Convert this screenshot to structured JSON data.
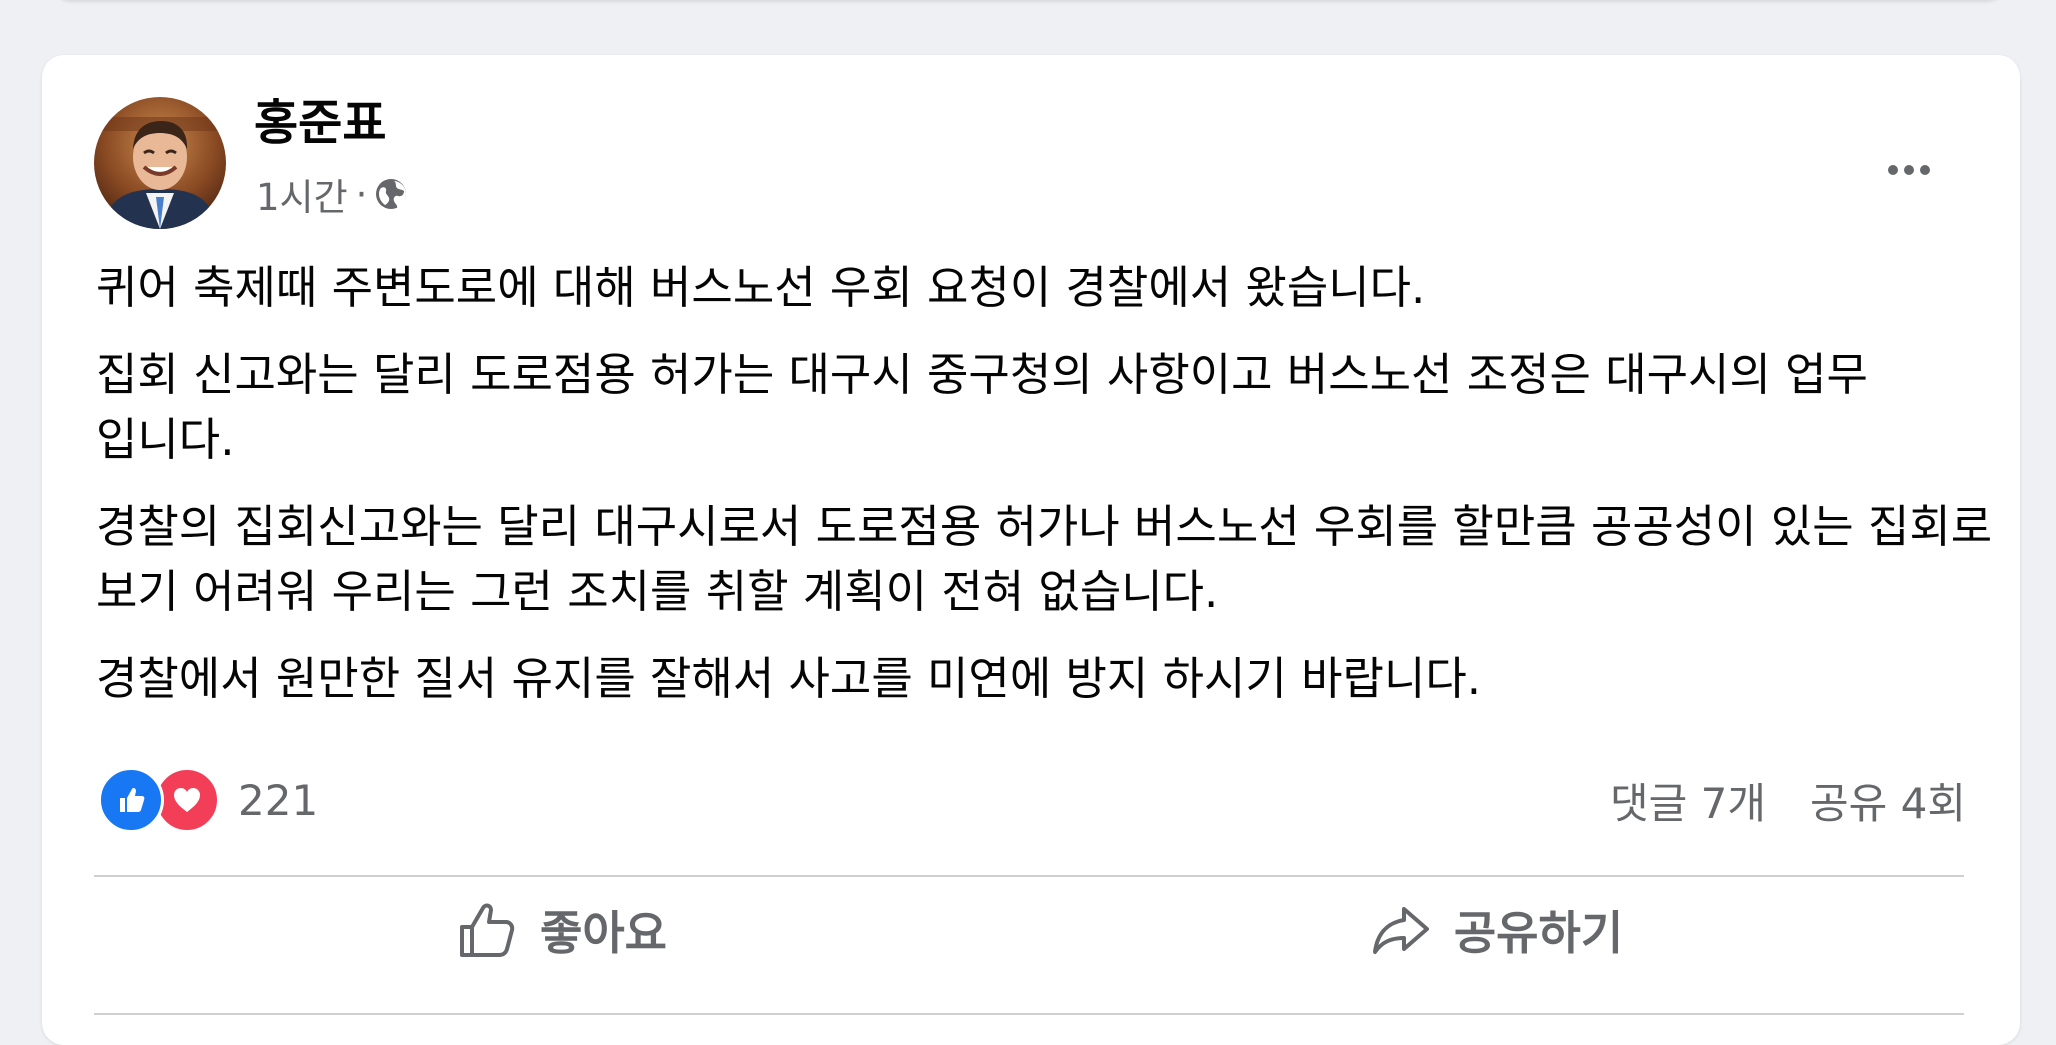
{
  "post": {
    "author": "홍준표",
    "time": "1시간",
    "separator": "·",
    "privacy_icon": "globe-icon",
    "more_icon": "more-options-icon",
    "paragraphs": [
      "퀴어 축제때 주변도로에 대해 버스노선 우회 요청이 경찰에서 왔습니다.",
      "집회 신고와는 달리 도로점용 허가는 대구시 중구청의 사항이고 버스노선 조정은 대구시의 업무 입니다.",
      "경찰의 집회신고와는 달리 대구시로서 도로점용 허가나 버스노선 우회를 할만큼 공공성이 있는 집회로 보기 어려워 우리는 그런 조치를 취할 계획이 전혀 없습니다.",
      "경찰에서 원만한 질서 유지를 잘해서 사고를 미연에 방지 하시기 바랍니다."
    ]
  },
  "reactions": {
    "icons": [
      "like-reaction-icon",
      "love-reaction-icon"
    ],
    "count": "221",
    "comments": "댓글 7개",
    "shares": "공유 4회"
  },
  "actions": {
    "like_label": "좋아요",
    "share_label": "공유하기"
  },
  "colors": {
    "background": "#eef0f4",
    "card": "#ffffff",
    "text": "#050505",
    "secondary_text": "#65676b",
    "like_blue": "#1877f2",
    "love_red": "#f33e58",
    "divider": "#ced0d4"
  }
}
